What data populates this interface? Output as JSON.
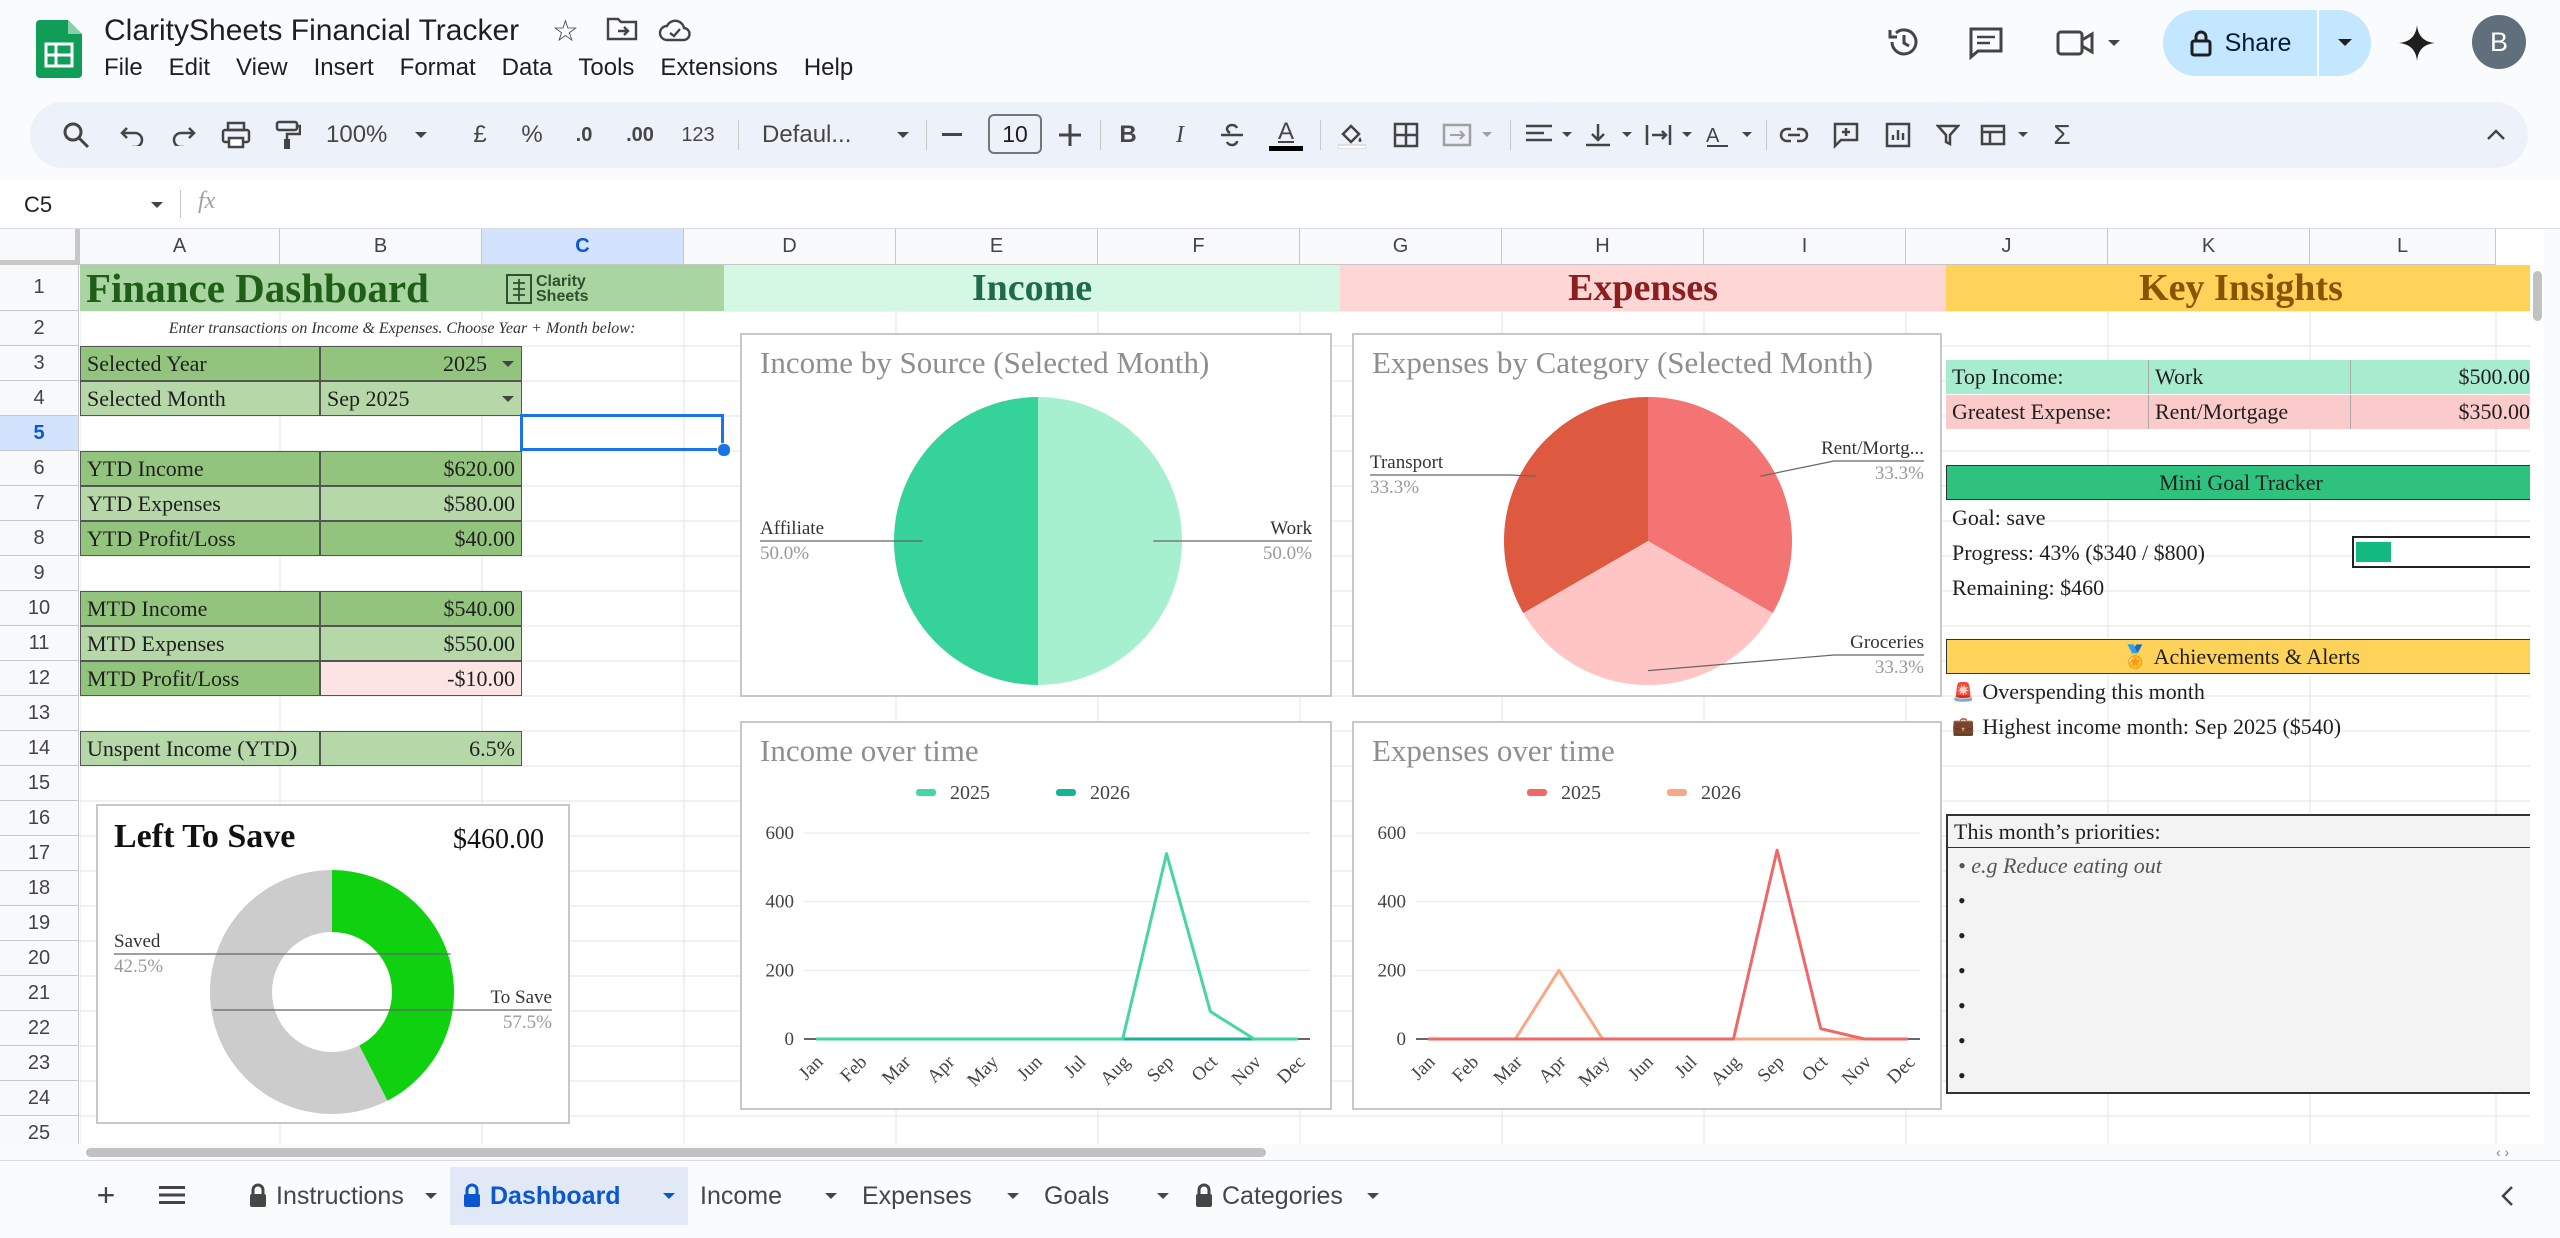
{
  "app": {
    "title": "ClaritySheets Financial Tracker",
    "menu": [
      "File",
      "Edit",
      "View",
      "Insert",
      "Format",
      "Data",
      "Tools",
      "Extensions",
      "Help"
    ],
    "share_label": "Share",
    "avatar_initial": "B",
    "brand_color": "#0f9d58"
  },
  "toolbar": {
    "zoom": "100%",
    "currency": "£",
    "percent": "%",
    "decrease_decimal": ".0",
    "increase_decimal": ".00",
    "number_format": "123",
    "font": "Defaul...",
    "font_size": "10",
    "bold": "B",
    "italic": "I",
    "text_color_letter": "A",
    "sum": "Σ"
  },
  "formula_bar": {
    "cell_ref": "C5",
    "fx": "fx",
    "value": ""
  },
  "columns": [
    "A",
    "B",
    "C",
    "D",
    "E",
    "F",
    "G",
    "H",
    "I",
    "J",
    "K",
    "L"
  ],
  "rows": [
    "1",
    "2",
    "3",
    "4",
    "5",
    "6",
    "7",
    "8",
    "9",
    "10",
    "11",
    "12",
    "13",
    "14",
    "15",
    "16",
    "17",
    "18",
    "19",
    "20",
    "21",
    "22",
    "23",
    "24",
    "25"
  ],
  "sheet": {
    "dashboard_title": "Finance Dashboard",
    "logo_text_1": "Clarity",
    "logo_text_2": "Sheets",
    "income_header": "Income",
    "expenses_header": "Expenses",
    "insights_header": "Key Insights",
    "instruction": "Enter transactions on Income & Expenses. Choose Year + Month below:",
    "selected_year_label": "Selected Year",
    "selected_year": "2025",
    "selected_month_label": "Selected Month",
    "selected_month": "Sep 2025",
    "ytd_income_label": "YTD Income",
    "ytd_income": "$620.00",
    "ytd_expenses_label": "YTD Expenses",
    "ytd_expenses": "$580.00",
    "ytd_pl_label": "YTD Profit/Loss",
    "ytd_pl": "$40.00",
    "mtd_income_label": "MTD Income",
    "mtd_income": "$540.00",
    "mtd_expenses_label": "MTD Expenses",
    "mtd_expenses": "$550.00",
    "mtd_pl_label": "MTD Profit/Loss",
    "mtd_pl": "-$10.00",
    "unspent_label": "Unspent Income (YTD)",
    "unspent": "6.5%"
  },
  "insights": {
    "top_income_label": "Top Income:",
    "top_income_cat": "Work",
    "top_income_val": "$500.00",
    "greatest_expense_label": "Greatest Expense:",
    "greatest_expense_cat": "Rent/Mortgage",
    "greatest_expense_val": "$350.00",
    "goal_tracker_title": "Mini Goal Tracker",
    "goal": "Goal: save",
    "progress": "Progress: 43%  ($340 / $800)",
    "progress_fraction": 0.43,
    "remaining": "Remaining: $460",
    "achievements_title": "🏅 Achievements & Alerts",
    "alert_1_icon": "🚨",
    "alert_1": "Overspending this month",
    "alert_2_icon": "💼",
    "alert_2": "Highest income month: Sep 2025 ($540)",
    "priorities_title": "This month’s priorities:",
    "priorities": [
      "• e.g Reduce eating out",
      "•",
      "•",
      "•",
      "•",
      "•",
      "•"
    ]
  },
  "chart_data": [
    {
      "type": "pie",
      "title": "Income by Source (Selected Month)",
      "labels": [
        "Work",
        "Affiliate"
      ],
      "values": [
        50.0,
        50.0
      ],
      "pct_labels": [
        "50.0%",
        "50.0%"
      ],
      "colors": [
        "#a6f0d0",
        "#35d39a"
      ]
    },
    {
      "type": "pie",
      "title": "Expenses by Category (Selected Month)",
      "labels": [
        "Rent/Mortg...",
        "Groceries",
        "Transport"
      ],
      "values": [
        33.3,
        33.3,
        33.3
      ],
      "pct_labels": [
        "33.3%",
        "33.3%",
        "33.3%"
      ],
      "colors": [
        "#f47373",
        "#ffc5c5",
        "#dd5a40"
      ]
    },
    {
      "type": "line",
      "title": "Income over time",
      "categories": [
        "Jan",
        "Feb",
        "Mar",
        "Apr",
        "May",
        "Jun",
        "Jul",
        "Aug",
        "Sep",
        "Oct",
        "Nov",
        "Dec"
      ],
      "series": [
        {
          "name": "2025",
          "color": "#46d6a0",
          "values": [
            0,
            0,
            0,
            0,
            0,
            0,
            0,
            0,
            540,
            80,
            0,
            0
          ]
        },
        {
          "name": "2026",
          "color": "#14b593",
          "values": [
            0,
            0,
            0,
            0,
            0,
            0,
            0,
            0,
            0,
            0,
            0,
            0
          ]
        }
      ],
      "ylim": [
        0,
        600
      ],
      "yticks": [
        0,
        200,
        400,
        600
      ]
    },
    {
      "type": "line",
      "title": "Expenses over time",
      "categories": [
        "Jan",
        "Feb",
        "Mar",
        "Apr",
        "May",
        "Jun",
        "Jul",
        "Aug",
        "Sep",
        "Oct",
        "Nov",
        "Dec"
      ],
      "series": [
        {
          "name": "2025",
          "color": "#ef6767",
          "values": [
            0,
            0,
            0,
            0,
            0,
            0,
            0,
            0,
            550,
            30,
            0,
            0
          ]
        },
        {
          "name": "2026",
          "color": "#f9a886",
          "values": [
            0,
            0,
            0,
            200,
            0,
            0,
            0,
            0,
            0,
            0,
            0,
            0
          ]
        }
      ],
      "ylim": [
        0,
        600
      ],
      "yticks": [
        0,
        200,
        400,
        600
      ]
    },
    {
      "type": "pie",
      "title": "Left To Save",
      "value_text": "$460.00",
      "labels": [
        "Saved",
        "To Save"
      ],
      "values": [
        42.5,
        57.5
      ],
      "pct_labels": [
        "42.5%",
        "57.5%"
      ],
      "colors": [
        "#0fd10f",
        "#cccccc"
      ]
    }
  ],
  "tabs": {
    "add": "+",
    "items": [
      {
        "label": "Instructions",
        "locked": true
      },
      {
        "label": "Dashboard",
        "locked": true,
        "active": true
      },
      {
        "label": "Income",
        "locked": false
      },
      {
        "label": "Expenses",
        "locked": false
      },
      {
        "label": "Goals",
        "locked": false
      },
      {
        "label": "Categories",
        "locked": true
      }
    ]
  }
}
